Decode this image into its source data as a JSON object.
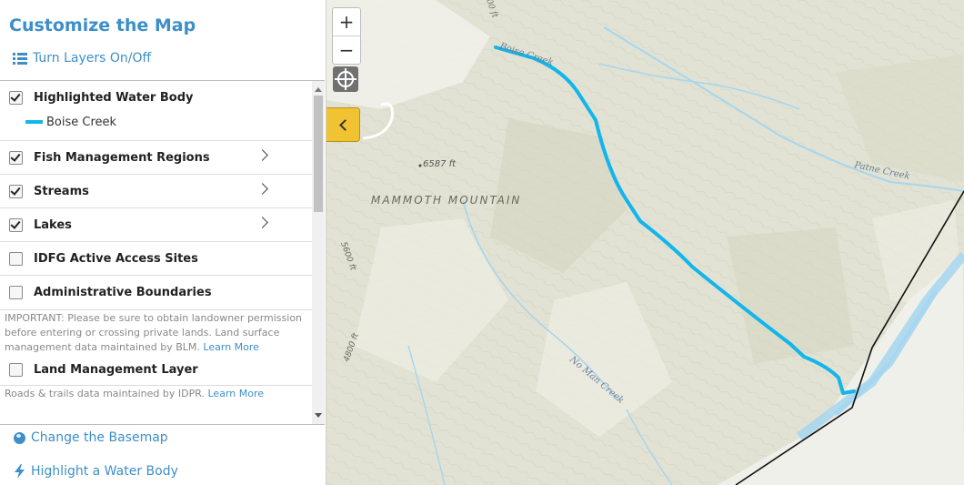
{
  "panel": {
    "title": "Customize the Map",
    "layers_link": "Turn Layers On/Off",
    "layers": [
      {
        "label": "Highlighted Water Body",
        "checked": true,
        "expandable": false
      },
      {
        "label": "Fish Management Regions",
        "checked": true,
        "expandable": true
      },
      {
        "label": "Streams",
        "checked": true,
        "expandable": true
      },
      {
        "label": "Lakes",
        "checked": true,
        "expandable": true
      },
      {
        "label": "IDFG Active Access Sites",
        "checked": false,
        "expandable": false
      },
      {
        "label": "Administrative Boundaries",
        "checked": false,
        "expandable": false
      },
      {
        "label": "Land Management Layer",
        "checked": false,
        "expandable": false
      }
    ],
    "legend": {
      "label": "Boise Creek",
      "color": "#13b5ea"
    },
    "land_note": "IMPORTANT: Please be sure to obtain landowner permission before entering or crossing private lands. Land surface management data maintained by BLM.",
    "land_note_link": "Learn More",
    "roads_note": "Roads & trails data maintained by IDPR.",
    "roads_note_link": "Learn More",
    "basemap_link": "Change the Basemap",
    "highlight_link": "Highlight a Water Body"
  },
  "map": {
    "zoom_in": "+",
    "zoom_out": "−",
    "labels": {
      "mountain": "MAMMOTH MOUNTAIN",
      "elev_summit": "6587 ft",
      "elev_5600": "5600 ft",
      "elev_4800": "4800 ft",
      "elev_top": "00 ft",
      "boise_creek": "Boise Creek",
      "patne_creek": "Patne Creek",
      "no_man_creek": "No Man Creek"
    },
    "colors": {
      "highlight": "#13b5ea",
      "stream": "#a6d6f0",
      "terrain": "#e1e2d3",
      "accent": "#f1c232"
    }
  },
  "colors": {
    "link": "#3d8fc9"
  }
}
